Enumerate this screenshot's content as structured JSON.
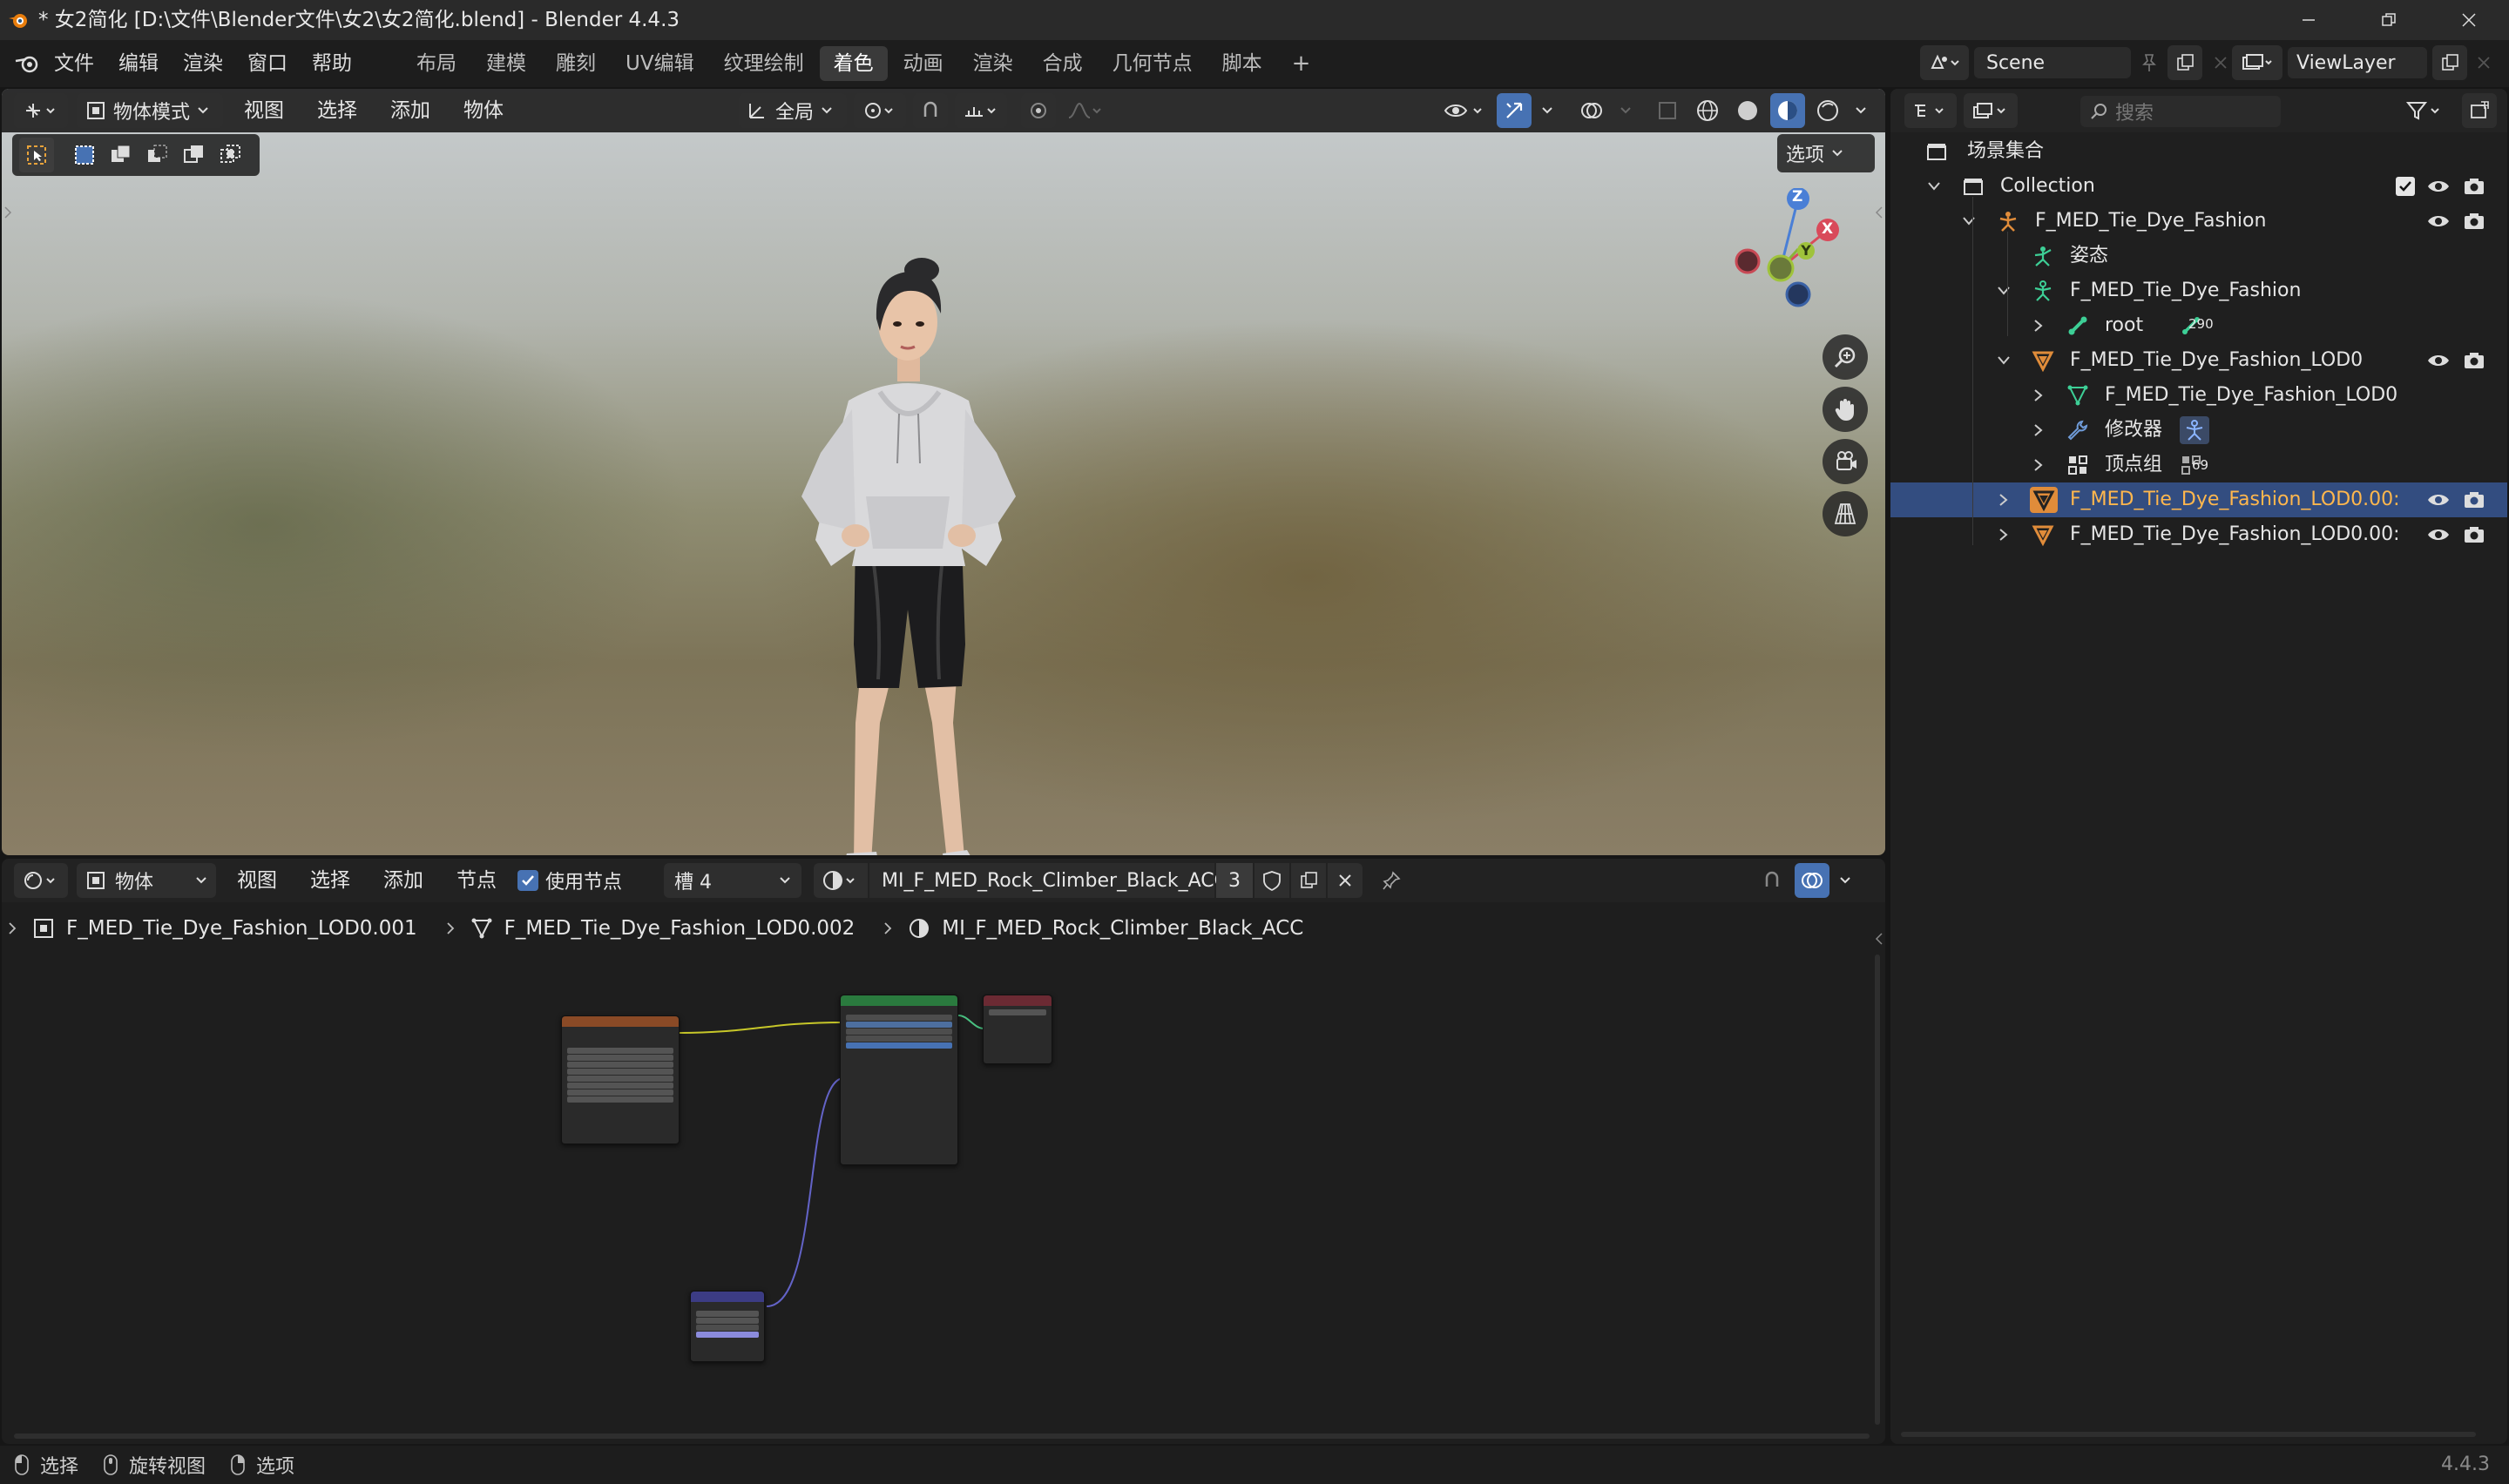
{
  "window": {
    "title": "* 女2简化 [D:\\文件\\Blender文件\\女2\\女2简化.blend] - Blender 4.4.3"
  },
  "menubar": {
    "items": [
      "文件",
      "编辑",
      "渲染",
      "窗口",
      "帮助"
    ],
    "workspaces": [
      "布局",
      "建模",
      "雕刻",
      "UV编辑",
      "纹理绘制",
      "着色",
      "动画",
      "渲染",
      "合成",
      "几何节点",
      "脚本"
    ],
    "active_workspace": "着色",
    "add_tab": "+",
    "scene": "Scene",
    "view_layer": "ViewLayer"
  },
  "viewport": {
    "mode": "物体模式",
    "menus": [
      "视图",
      "选择",
      "添加",
      "物体"
    ],
    "transform_orientation": "全局",
    "options_label": "选项",
    "gizmo_axes": {
      "z": "Z",
      "y": "Y",
      "x": "X"
    }
  },
  "node_editor": {
    "editor_type": "物体",
    "menus": [
      "视图",
      "选择",
      "添加",
      "节点"
    ],
    "use_nodes_label": "使用节点",
    "use_nodes_checked": true,
    "slot": "槽 4",
    "material_name": "MI_F_MED_Rock_Climber_Black_ACC",
    "user_count": "3",
    "breadcrumb": [
      "F_MED_Tie_Dye_Fashion_LOD0.001",
      "F_MED_Tie_Dye_Fashion_LOD0.002",
      "MI_F_MED_Rock_Climber_Black_ACC"
    ]
  },
  "outliner": {
    "search_placeholder": "搜索",
    "rows": [
      {
        "label": "场景集合",
        "indent": 0,
        "icon": "scene-collection-icon"
      },
      {
        "label": "Collection",
        "indent": 1,
        "icon": "collection-icon",
        "expanded": true,
        "checkbox": true
      },
      {
        "label": "F_MED_Tie_Dye_Fashion",
        "indent": 2,
        "icon": "armature-icon",
        "expanded": true
      },
      {
        "label": "姿态",
        "indent": 3,
        "icon": "pose-icon"
      },
      {
        "label": "F_MED_Tie_Dye_Fashion",
        "indent": 3,
        "icon": "armature-data-icon",
        "expanded": true
      },
      {
        "label": "root",
        "indent": 4,
        "icon": "bone-icon",
        "badge": "290"
      },
      {
        "label": "F_MED_Tie_Dye_Fashion_LOD0",
        "indent": 3,
        "icon": "mesh-icon",
        "expanded": true
      },
      {
        "label": "F_MED_Tie_Dye_Fashion_LOD0",
        "indent": 4,
        "icon": "mesh-data-icon"
      },
      {
        "label": "修改器",
        "indent": 4,
        "icon": "wrench-icon"
      },
      {
        "label": "顶点组",
        "indent": 4,
        "icon": "vertex-group-icon",
        "badge": "69"
      },
      {
        "label": "F_MED_Tie_Dye_Fashion_LOD0.00:",
        "indent": 3,
        "icon": "mesh-icon",
        "selected": true
      },
      {
        "label": "F_MED_Tie_Dye_Fashion_LOD0.00:",
        "indent": 3,
        "icon": "mesh-icon"
      }
    ]
  },
  "statusbar": {
    "select": "选择",
    "rotate": "旋转视图",
    "options": "选项",
    "version": "4.4.3"
  },
  "colors": {
    "accent": "#4772b3",
    "selected_row": "#334d80",
    "selected_text": "#ffb74d",
    "mesh_orange": "#e08c3a",
    "armature_green": "#3dcf96"
  }
}
